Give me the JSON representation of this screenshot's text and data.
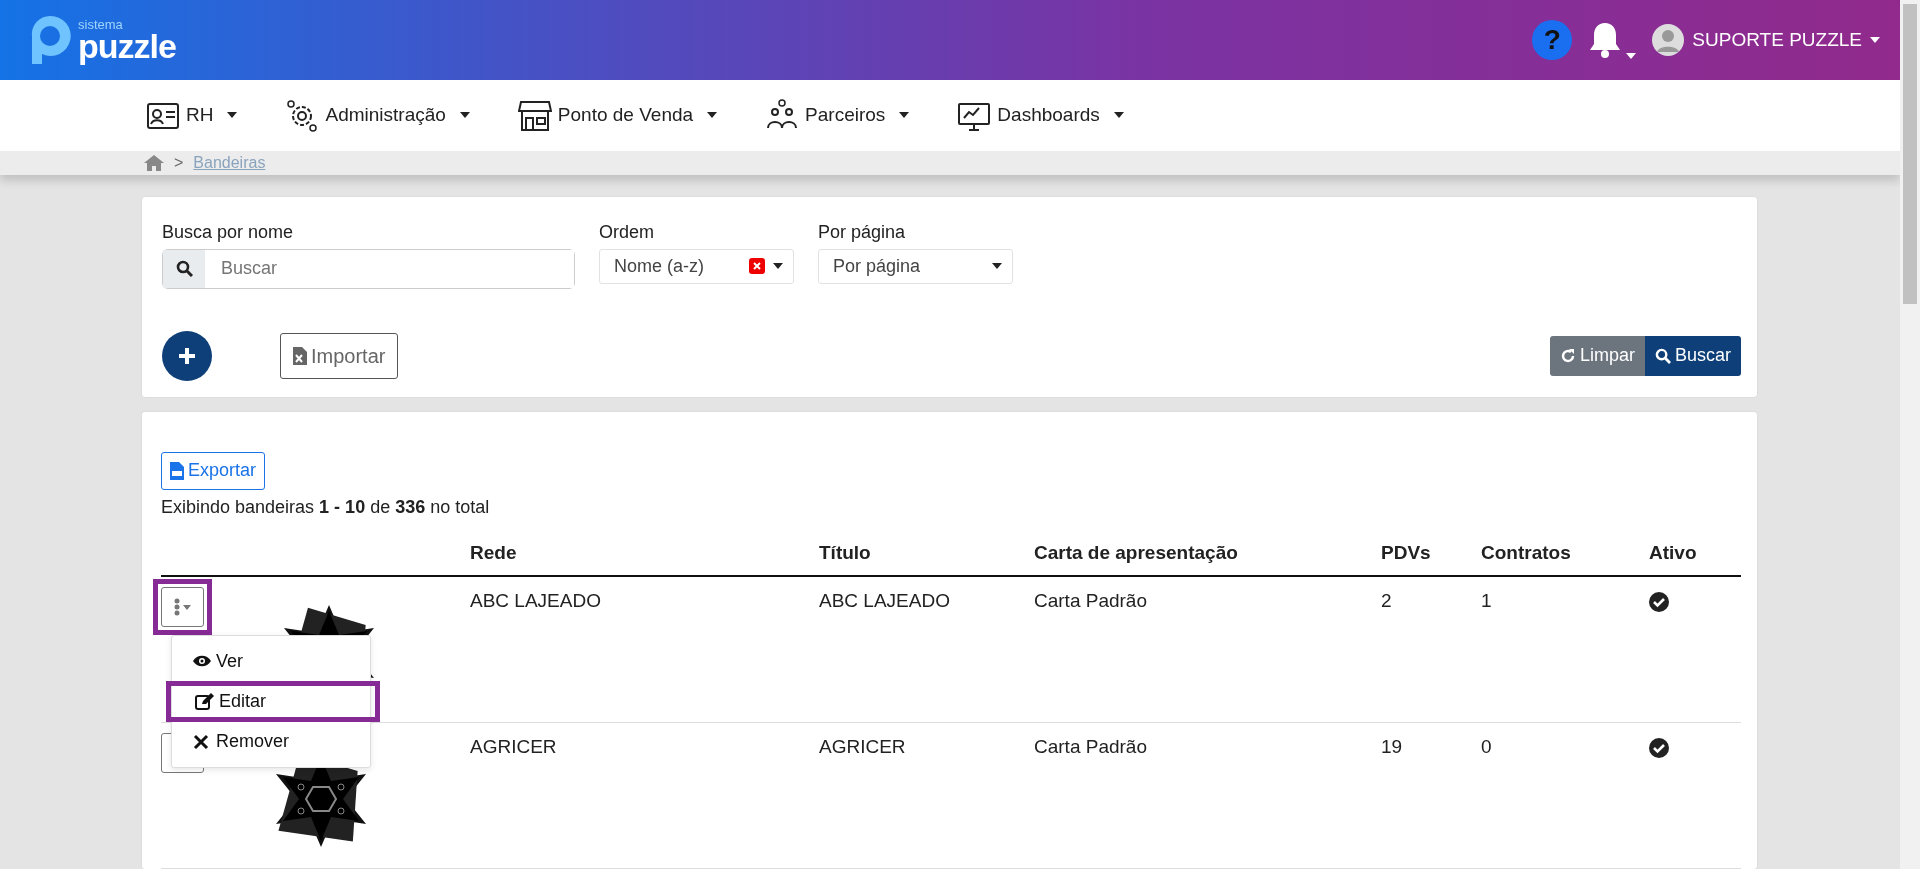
{
  "header": {
    "logo_small": "sistema",
    "logo_big": "puzzle",
    "help": "?",
    "user": "SUPORTE PUZZLE"
  },
  "nav": [
    {
      "kind": "id-card",
      "label": "RH"
    },
    {
      "kind": "gears",
      "label": "Administração"
    },
    {
      "kind": "store",
      "label": "Ponto de Venda"
    },
    {
      "kind": "people",
      "label": "Parceiros"
    },
    {
      "kind": "monitor",
      "label": "Dashboards"
    }
  ],
  "breadcrumb_separator": ">",
  "breadcrumb": [
    "Bandeiras"
  ],
  "filters": {
    "search_label": "Busca por nome",
    "search_placeholder": "Buscar",
    "order_label": "Ordem",
    "order_value": "Nome (a-z)",
    "per_page_label": "Por página",
    "per_page_value": "Por página",
    "import": "Importar",
    "clear": "Limpar",
    "search": "Buscar"
  },
  "results": {
    "export": "Exportar",
    "summary": "Exibindo bandeiras **1 - 10** de **336** no total",
    "columns": [
      "Rede",
      "Título",
      "Carta de apresentação",
      "PDVs",
      "Contratos",
      "Ativo"
    ],
    "rows": [
      {
        "rede": "ABC LAJEADO",
        "titulo": "ABC LAJEADO",
        "carta": "Carta Padrão",
        "pdvs": "2",
        "contratos": "1",
        "active": true,
        "highlighted": true
      },
      {
        "rede": "AGRICER",
        "titulo": "AGRICER",
        "carta": "Carta Padrão",
        "pdvs": "19",
        "contratos": "0",
        "active": true,
        "highlighted": false
      }
    ],
    "menu": [
      {
        "kind": "eye",
        "label": "Ver",
        "highlighted": false
      },
      {
        "kind": "edit",
        "label": "Editar",
        "highlighted": true
      },
      {
        "kind": "times",
        "label": "Remover",
        "highlighted": false
      }
    ]
  }
}
